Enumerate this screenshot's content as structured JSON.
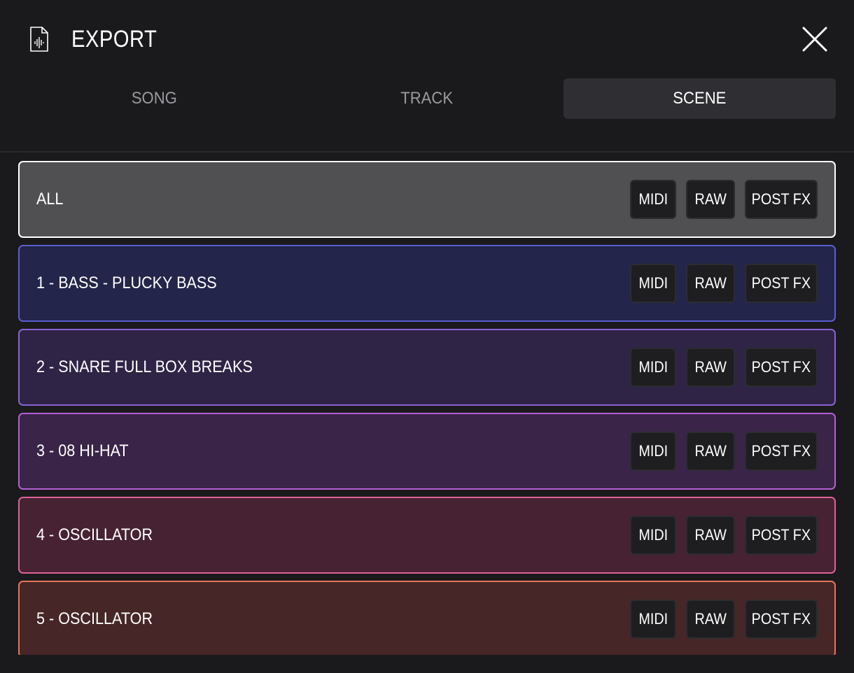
{
  "header": {
    "title": "EXPORT",
    "file_icon": "audio-file-icon",
    "close_icon": "close-icon"
  },
  "tabs": [
    {
      "label": "SONG",
      "active": false
    },
    {
      "label": "TRACK",
      "active": false
    },
    {
      "label": "SCENE",
      "active": true
    }
  ],
  "rows": [
    {
      "label": "ALL",
      "bg": "#505052",
      "border": "#ffffff"
    },
    {
      "label": "1 - BASS - PLUCKY BASS",
      "bg": "#23254a",
      "border": "#5a5ed0"
    },
    {
      "label": "2 - SNARE FULL BOX BREAKS",
      "bg": "#2f2446",
      "border": "#8a62d6"
    },
    {
      "label": "3 - 08 HI-HAT",
      "bg": "#3a2448",
      "border": "#b45fd6"
    },
    {
      "label": "4 - OSCILLATOR",
      "bg": "#462232",
      "border": "#e0609a"
    },
    {
      "label": "5 - OSCILLATOR",
      "bg": "#462626",
      "border": "#e8745a"
    }
  ],
  "buttons": {
    "midi": "MIDI",
    "raw": "RAW",
    "post_fx": "POST FX"
  }
}
